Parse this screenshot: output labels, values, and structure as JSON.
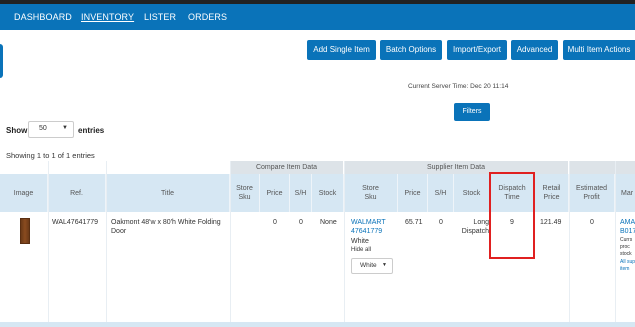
{
  "nav": {
    "items": [
      "DASHBOARD",
      "INVENTORY",
      "LISTER",
      "ORDERS"
    ]
  },
  "toolbar": {
    "buttons": [
      "Add Single Item",
      "Batch Options",
      "Import/Export",
      "Advanced",
      "Multi Item Actions"
    ]
  },
  "server_time": "Current Server Time: Dec 20 11:14",
  "filters_label": "Filters",
  "show": {
    "label": "Show",
    "value": "50",
    "suffix": "entries"
  },
  "showing_text": "Showing 1 to 1 of 1 entries",
  "groups": {
    "compare": "Compare Item Data",
    "supplier": "Supplier Item Data"
  },
  "columns": {
    "image": "Image",
    "ref": "Ref.",
    "title": "Title",
    "cmp_store_sku": "Store Sku",
    "cmp_price": "Price",
    "cmp_sh": "S/H",
    "cmp_stock": "Stock",
    "sup_store_sku": "Store Sku",
    "sup_price": "Price",
    "sup_sh": "S/H",
    "sup_stock": "Stock",
    "dispatch": "Dispatch Time",
    "retail": "Retail Price",
    "profit": "Estimated Profit",
    "market": "Mar"
  },
  "row": {
    "ref": "WAL47641779",
    "title": "Oakmont 48'w x 80'h White Folding Door",
    "cmp_price": "0",
    "cmp_sh": "0",
    "cmp_stock": "None",
    "sup_store_line1": "WALMART",
    "sup_store_line2": "47641779",
    "sup_variant": "White",
    "hide_all": "Hide all",
    "hide_select": "White",
    "sup_price": "65.71",
    "sup_sh": "0",
    "sup_stock": "Long Dispatch",
    "dispatch": "9",
    "retail": "121.49",
    "profit": "0",
    "market_line1": "AMA",
    "market_line2": "B017",
    "market_note1": "Currs",
    "market_note2": "proc",
    "market_note3": "stock",
    "market_link": "All sup",
    "market_note4": "item"
  },
  "colors": {
    "brand": "#0a73b9",
    "highlight": "#e02020",
    "header_bg": "#d6e7f3"
  }
}
